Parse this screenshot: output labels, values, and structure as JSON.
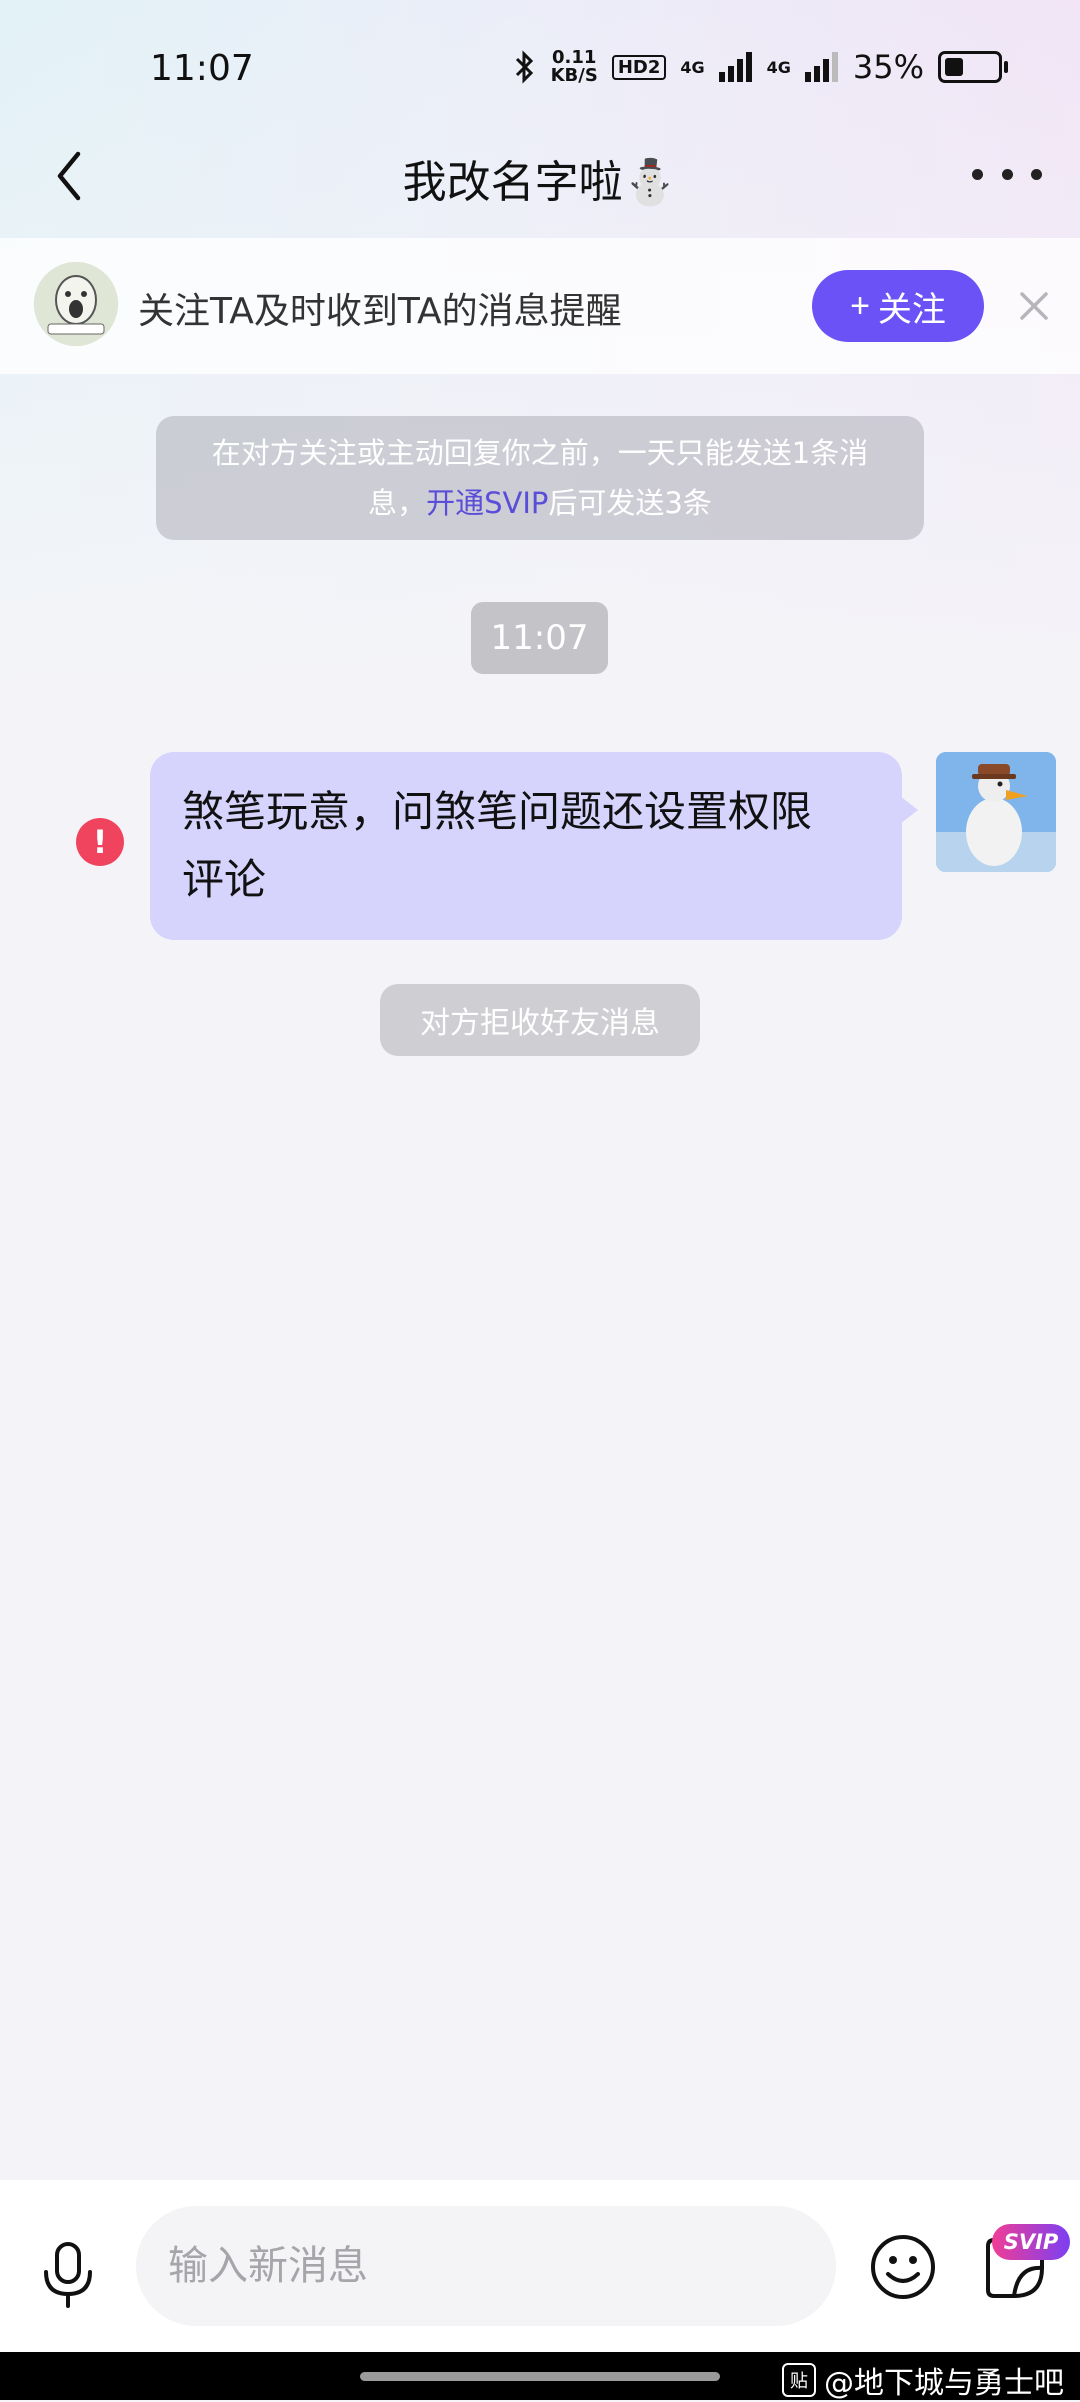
{
  "status_bar": {
    "time": "11:07",
    "speed_top": "0.11",
    "speed_bottom": "KB/S",
    "hd_label": "HD2",
    "signal1": "4G",
    "signal2": "4G",
    "battery_percent": "35%",
    "battery_level": 0.35
  },
  "header": {
    "title": "我改名字啦⛄"
  },
  "follow_bar": {
    "text": "关注TA及时收到TA的消息提醒",
    "button_plus": "+",
    "button_label": "关注"
  },
  "notice": {
    "line1": "在对方关注或主动回复你之前，一天只能发送1条消",
    "line2_prefix": "息，",
    "link": "开通SVIP",
    "line2_suffix": "后可发送3条"
  },
  "chat": {
    "timestamp": "11:07",
    "error_mark": "!",
    "message_line1": "煞笔玩意，问煞笔问题还设置权限",
    "message_line2": "评论",
    "system_notice": "对方拒收好友消息"
  },
  "input_bar": {
    "placeholder": "输入新消息",
    "svip_badge": "SVIP"
  },
  "watermark": {
    "icon": "贴",
    "text": "@地下城与勇士吧"
  },
  "colors": {
    "accent": "#6a52f7",
    "bubble": "#d6d3fd",
    "error": "#f0445e",
    "link": "#5a4ed8"
  }
}
